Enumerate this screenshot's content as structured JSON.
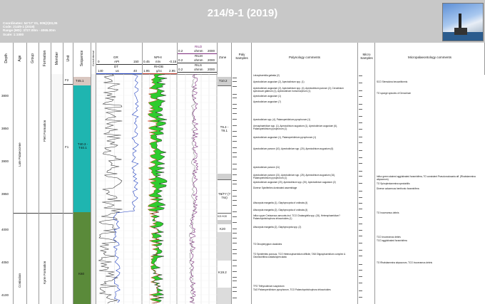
{
  "page": {
    "title": "214/9-1 (2019)",
    "info_lines": [
      "Coordinates: 54°17' 01, 005(2)03,05",
      "Code:       214/9-1 (2019)",
      "Range (MD): 3727.00m - 4065.00m",
      "Scale:        1:1000"
    ]
  },
  "columns": {
    "depth": "Depth",
    "age": "Age",
    "group": "Group",
    "formation": "Formation",
    "member": "Member",
    "unit": "Unit",
    "sequence": "Sequence",
    "cored": "Cored interval",
    "zone": "Zone",
    "paly_samples": "Paly Samples",
    "paly_comments": "Palynology comments",
    "micro_samples": "Micro Samples",
    "micro_comments": "Micropalaeontology comments"
  },
  "logs": {
    "gr": {
      "name": "GR",
      "unit": "API",
      "min": "0",
      "max": "150",
      "color": "#333333"
    },
    "dt": {
      "name": "DT",
      "unit": "us",
      "min": "140",
      "max": "40",
      "color": "#1f3fbf"
    },
    "nphi": {
      "name": "NPHI",
      "unit": "m/v",
      "min": "0.45",
      "max": "-0.15"
    },
    "rhob": {
      "name": "RHOB",
      "unit": "g/cc",
      "min": "1.95",
      "max": "2.95"
    },
    "rild": {
      "name": "RILD",
      "unit": "ohmm",
      "min": "0.2",
      "max": "2000",
      "color": "#7b2a7b"
    },
    "rilm": {
      "name": "RILM",
      "unit": "ohmm",
      "min": "0.2",
      "max": "2000"
    },
    "rils": {
      "name": "RILS",
      "unit": "ohmm",
      "min": "0.2",
      "max": "2000"
    },
    "fill_color": "#2ecc2e",
    "cross_color": "#e03020"
  },
  "depth_ticks": [
    "3800",
    "3850",
    "3900",
    "3950",
    "4000",
    "4050",
    "4100"
  ],
  "age": [
    {
      "label": "Late Palaeocene"
    },
    {
      "label": "Coniacian"
    }
  ],
  "formation": [
    {
      "label": "Flett Formation"
    },
    {
      "label": "Kyrre Formation"
    }
  ],
  "unit": [
    {
      "label": "F2"
    },
    {
      "label": "F1"
    }
  ],
  "sequence": [
    {
      "label": "T45.1",
      "color": "#d9c7c0"
    },
    {
      "label": "T40.3 - T40.1",
      "color": "#1fb5b0"
    },
    {
      "label": "K60",
      "color": "#5a8a3a"
    }
  ],
  "zones": [
    {
      "label": "T10.2"
    },
    {
      "label": "T9.4 - T9.1"
    },
    {
      "label": "T8/T7 (?7ss)"
    },
    {
      "label": "K21+K20"
    },
    {
      "label": "K20"
    },
    {
      "label": "K19.2"
    }
  ],
  "paly_comments": [
    "Leiosphaeridia galeata (2)",
    "Apectodinium augustum (2), Apectodinium spp. (1)",
    "Apectodinium augustum (2), Apectodinium spp. (4), Apectodinium parvum (2), Cerodinium speciosum glabrum (1), Apectodinium homomorphum (1)",
    "Apectodinium augustum (1)",
    "Apectodinium augustum (7)",
    "Apectodinium spp. (4), Palaeoperidinium pyrophorum (1)",
    "Areosphaeridium spp. (1), Apectodinium augustum (1), Apectodinium augustum (6), Palaeoperidinium pyrophorum (1)",
    "Apectodinium augustum (1), Palaeoperidinium pyrophorum (1)",
    "Apectodinium parvum (10), Apectodinium spp. (20), Apectodinium augustum (6)",
    "Apectodinium parvum (11)",
    "Apectodinium parvum (21), Apectodinium spp. (25), Apectodinium augustum (16), Palaeoperidinium pyrophorum (1)",
    "Apectodinium augustum (20), Apectodinium spp. (20), Apectodinium augustum (2)",
    "Diverse Spiniferites dominated assemblage",
    "Alisocysta margarita (1), Glaphyrocysta of ordinata (4)",
    "Alisocysta margarita (2), Glaphyrocysta of ordinata (4)",
    "Influx upper Cretaceous amounts incl. TCO Chatangiella spp. (15), Hetersphaeridium? Palaeohystrichophora infusorioides (1)",
    "Alisocysta margarita (2), Glaphyrocysta spp. (2)",
    "TO Dinopterygium cladoides",
    "TO Spiniferites porosus, TCO Heterosphaeridium difficile, TAB Oligosphaeridium complex & Odontochitina costata/operculata",
    "TAO Palaeoperidinium pyrophorum, TCO Palaeohystrichophora infusorioides",
    "TFO Trithyrodinium suspectum"
  ],
  "micro_comments": [
    "SCO Stensioina beccariiformis",
    "TO sponge spicules of Gerochium",
    "Influx green stained agglutinated foraminifera, TO consistent Pseudonodosaria aff. (Rhabdammina abyssorum)",
    "TO Spiroplectammina spectabilis",
    "Diverse calcareous benthonic foraminifera",
    "TO Inoceramus debris",
    "TCO Inoceramus debris",
    "TCO agglutinated foraminifera",
    "TO Rhabdammina abyssorum, TCO Inoceramus debris"
  ]
}
